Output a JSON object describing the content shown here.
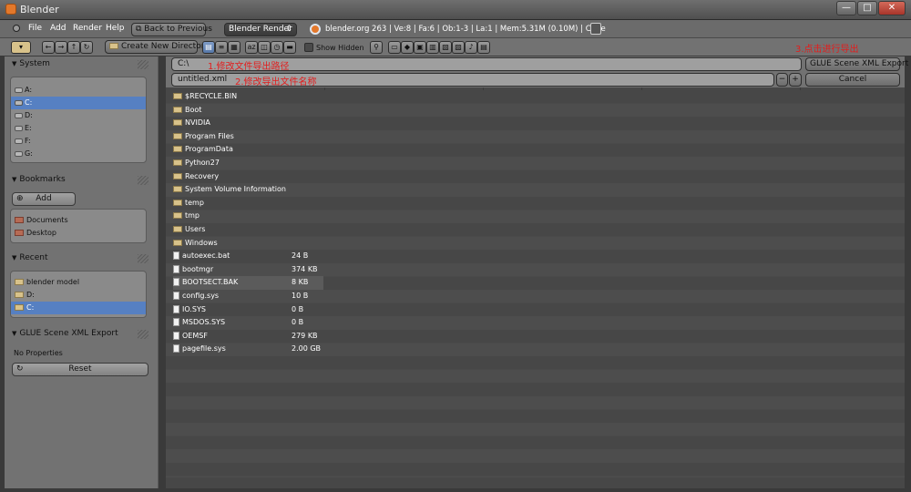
{
  "window": {
    "title": "Blender",
    "btn_min": "—",
    "btn_max": "□",
    "btn_close": "✕"
  },
  "menu": {
    "items": [
      "File",
      "Add",
      "Render",
      "Help"
    ],
    "back_button": "Back to Previous",
    "render_engine": "Blender Render",
    "stats": "blender.org 263 | Ve:8 | Fa:6 | Ob:1-3 | La:1 | Mem:5.31M (0.10M) | Cube"
  },
  "toolbar": {
    "create_dir": "Create New Directory",
    "show_hidden": "Show Hidden"
  },
  "left": {
    "system": {
      "title": "System",
      "items": [
        "A:",
        "C:",
        "D:",
        "E:",
        "F:",
        "G:"
      ],
      "selected": 1
    },
    "bookmarks": {
      "title": "Bookmarks",
      "add_label": "Add",
      "items": [
        "Documents",
        "Desktop"
      ]
    },
    "recent": {
      "title": "Recent",
      "items": [
        "blender model",
        "D:",
        "C:"
      ],
      "selected": 2
    },
    "export": {
      "title": "GLUE Scene XML Export",
      "no_props": "No Properties",
      "reset": "Reset"
    }
  },
  "right": {
    "path": "C:\\",
    "filename": "untitled.xml",
    "export_button": "GLUE Scene XML Export",
    "cancel_button": "Cancel",
    "minus": "−",
    "plus": "+",
    "annotation_path": "1.修改文件导出路径",
    "annotation_filename": "2.修改导出文件名称",
    "annotation_export": "3.点击进行导出"
  },
  "files": [
    {
      "name": "$RECYCLE.BIN",
      "type": "folder",
      "size": ""
    },
    {
      "name": "Boot",
      "type": "folder",
      "size": ""
    },
    {
      "name": "NVIDIA",
      "type": "folder",
      "size": ""
    },
    {
      "name": "Program Files",
      "type": "folder",
      "size": ""
    },
    {
      "name": "ProgramData",
      "type": "folder",
      "size": ""
    },
    {
      "name": "Python27",
      "type": "folder",
      "size": ""
    },
    {
      "name": "Recovery",
      "type": "folder",
      "size": ""
    },
    {
      "name": "System Volume Information",
      "type": "folder",
      "size": ""
    },
    {
      "name": "temp",
      "type": "folder",
      "size": ""
    },
    {
      "name": "tmp",
      "type": "folder",
      "size": ""
    },
    {
      "name": "Users",
      "type": "folder",
      "size": ""
    },
    {
      "name": "Windows",
      "type": "folder",
      "size": ""
    },
    {
      "name": "autoexec.bat",
      "type": "file",
      "size": "24 B"
    },
    {
      "name": "bootmgr",
      "type": "file",
      "size": "374 KB"
    },
    {
      "name": "BOOTSECT.BAK",
      "type": "file",
      "size": "8 KB"
    },
    {
      "name": "config.sys",
      "type": "file",
      "size": "10 B"
    },
    {
      "name": "IO.SYS",
      "type": "file",
      "size": "0 B"
    },
    {
      "name": "MSDOS.SYS",
      "type": "file",
      "size": "0 B"
    },
    {
      "name": "OEMSF",
      "type": "file",
      "size": "279 KB"
    },
    {
      "name": "pagefile.sys",
      "type": "file",
      "size": "2.00 GB"
    }
  ],
  "highlighted_file": 14,
  "colors": {
    "selection": "#5680c2",
    "annotation": "#e31d1d"
  }
}
